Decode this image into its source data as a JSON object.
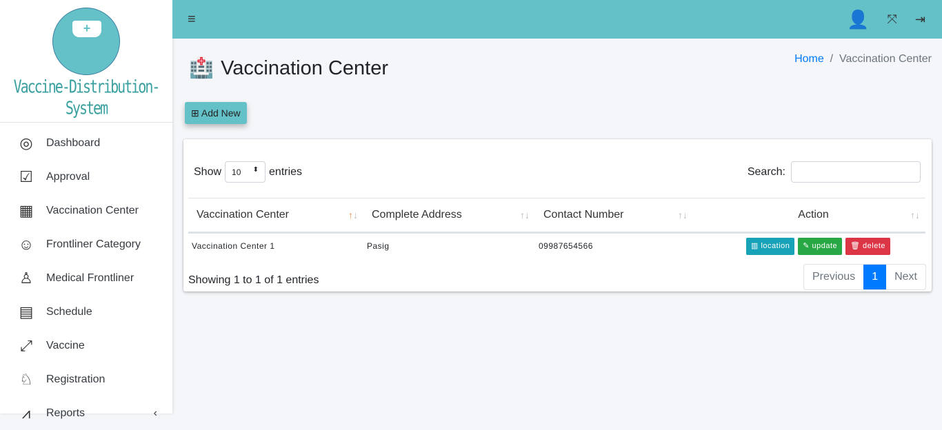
{
  "brand": {
    "name": "Vaccine-Distribution-System",
    "accent": "#63c1c7"
  },
  "sidebar": {
    "items": [
      {
        "label": "Dashboard",
        "icon": "gauge-icon"
      },
      {
        "label": "Approval",
        "icon": "head-check-icon"
      },
      {
        "label": "Vaccination Center",
        "icon": "hospital-icon"
      },
      {
        "label": "Frontliner Category",
        "icon": "people-icon"
      },
      {
        "label": "Medical Frontliner",
        "icon": "nurse-icon"
      },
      {
        "label": "Schedule",
        "icon": "calendar-icon"
      },
      {
        "label": "Vaccine",
        "icon": "syringe-icon"
      },
      {
        "label": "Registration",
        "icon": "doctor-icon"
      },
      {
        "label": "Reports",
        "icon": "chart-icon"
      }
    ]
  },
  "page": {
    "title": "Vaccination Center",
    "breadcrumb": {
      "home": "Home",
      "current": "Vaccination Center"
    },
    "add_label": "Add New"
  },
  "table": {
    "show": "Show",
    "entries_value": "10",
    "entries": "entries",
    "search_label": "Search:",
    "search_value": "",
    "columns": [
      "Vaccination Center",
      "Complete Address",
      "Contact Number",
      "Action"
    ],
    "rows": [
      {
        "center": "Vaccination Center 1",
        "address": "Pasig",
        "contact": "09987654566"
      }
    ],
    "actions": {
      "location": "location",
      "update": "update",
      "delete": "delete"
    },
    "info": "Showing 1 to 1 of 1 entries",
    "pager": {
      "prev": "Previous",
      "page": "1",
      "next": "Next"
    }
  }
}
